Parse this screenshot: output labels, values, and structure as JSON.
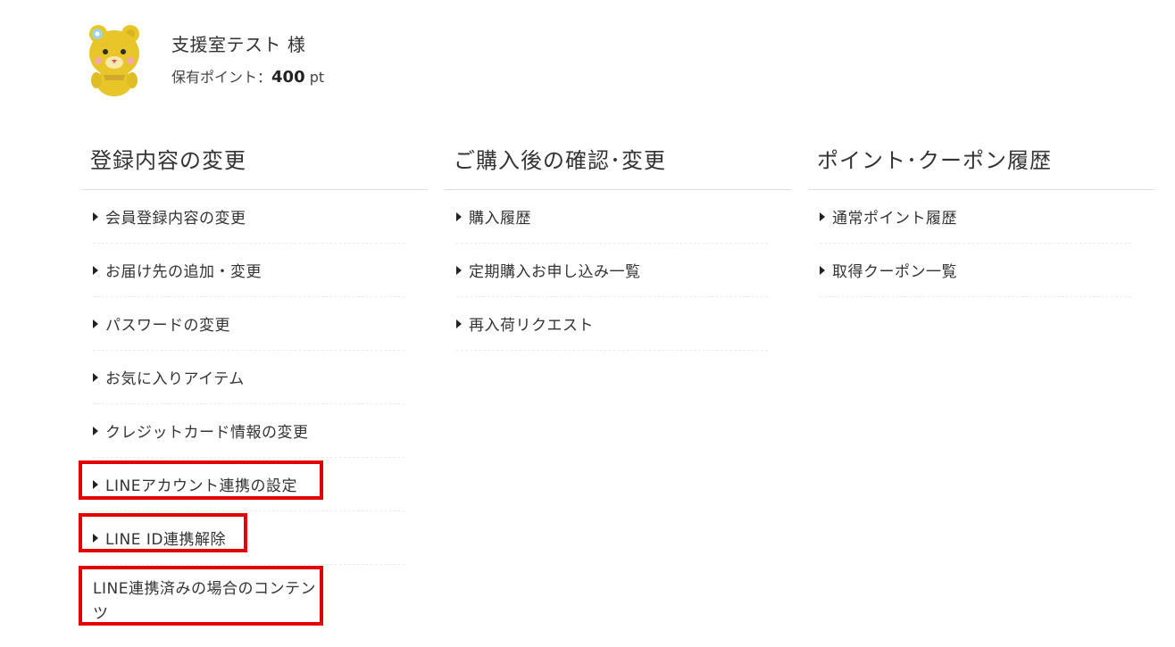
{
  "user": {
    "name": "支援室テスト 様",
    "points_label": "保有ポイント：",
    "points_value": "400",
    "points_unit": "pt"
  },
  "columns": [
    {
      "title": "登録内容の変更",
      "items": [
        "会員登録内容の変更",
        "お届け先の追加・変更",
        "パスワードの変更",
        "お気に入りアイテム",
        "クレジットカード情報の変更",
        "LINEアカウント連携の設定",
        "LINE ID連携解除"
      ]
    },
    {
      "title": "ご購入後の確認･変更",
      "items": [
        "購入履歴",
        "定期購入お申し込み一覧",
        "再入荷リクエスト"
      ]
    },
    {
      "title": "ポイント･クーポン履歴",
      "items": [
        "通常ポイント履歴",
        "取得クーポン一覧"
      ]
    }
  ],
  "line_content_text": "LINE連携済みの場合のコンテンツ",
  "colors": {
    "highlight": "#e30000",
    "avatar": "#e8c62a"
  },
  "icons": {
    "avatar": "bear-mascot-icon",
    "bullet": "caret-right-icon"
  }
}
